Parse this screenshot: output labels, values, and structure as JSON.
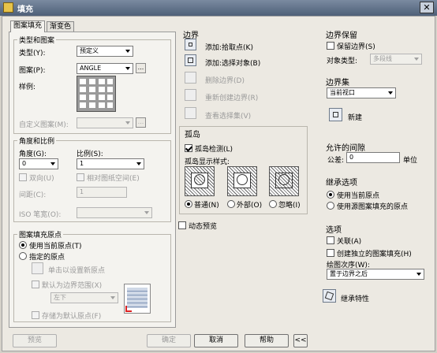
{
  "window": {
    "title": "填充",
    "close_symbol": "✕"
  },
  "tabs": [
    {
      "label": "图案填充"
    },
    {
      "label": "渐变色"
    }
  ],
  "type_pattern": {
    "group_title": "类型和图案",
    "type_label": "类型(Y):",
    "type_value": "预定义",
    "pattern_label": "图案(P):",
    "pattern_value": "ANGLE",
    "swatch_label": "样例:",
    "custom_label": "自定义图案(M):",
    "custom_value": ""
  },
  "angle_scale": {
    "group_title": "角度和比例",
    "angle_label": "角度(G):",
    "angle_value": "0",
    "scale_label": "比例(S):",
    "scale_value": "1",
    "double_label": "双向(U)",
    "relative_label": "相对图纸空间(E)",
    "spacing_label": "间距(C):",
    "spacing_value": "1",
    "iso_label": "ISO 笔宽(O):",
    "iso_value": ""
  },
  "origin": {
    "group_title": "图案填充原点",
    "use_current": "使用当前原点(T)",
    "specified": "指定的原点",
    "click_set": "单击以设置新原点",
    "default_extents": "默认为边界范围(X)",
    "position_value": "左下",
    "store_default": "存储为默认原点(F)"
  },
  "boundaries": {
    "title": "边界",
    "add_pick": "添加:拾取点(K)",
    "add_select": "添加:选择对象(B)",
    "remove": "删除边界(D)",
    "recreate": "重新创建边界(R)",
    "view_sel": "查看选择集(V)"
  },
  "islands": {
    "title": "孤岛",
    "detect_label": "孤岛检测(L)",
    "style_label": "孤岛显示样式:",
    "styles": [
      "普通(N)",
      "外部(O)",
      "忽略(I)"
    ]
  },
  "preview_dynamic": "动态预览",
  "retain": {
    "title": "边界保留",
    "keep_label": "保留边界(S)",
    "obj_type_label": "对象类型:",
    "obj_type_value": "多段线"
  },
  "boundary_set": {
    "title": "边界集",
    "value": "当前视口",
    "new_label": "新建"
  },
  "gap": {
    "title": "允许的间隙",
    "tol_label": "公差:",
    "tol_value": "0",
    "unit_label": "单位"
  },
  "inherit_opts": {
    "title": "继承选项",
    "opt1": "使用当前原点",
    "opt2": "使用源图案填充的原点"
  },
  "options": {
    "title": "选项",
    "assoc": "关联(A)",
    "separate": "创建独立的图案填充(H)",
    "draw_order_label": "绘图次序(W):",
    "draw_order_value": "置于边界之后"
  },
  "inherit_props": "继承特性",
  "footer": {
    "preview": "预览",
    "ok": "确定",
    "cancel": "取消",
    "help": "帮助",
    "collapse": "<<"
  }
}
